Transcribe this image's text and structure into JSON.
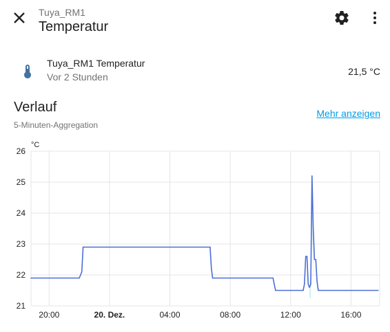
{
  "header": {
    "subtitle": "Tuya_RM1",
    "title": "Temperatur"
  },
  "icons": {
    "close": "close-icon",
    "settings": "gear-icon",
    "more": "more-vertical-icon",
    "entity": "thermometer-icon"
  },
  "entity": {
    "name": "Tuya_RM1 Temperatur",
    "last_changed": "Vor 2 Stunden",
    "value": "21,5 °C"
  },
  "history": {
    "title": "Verlauf",
    "aggregation": "5-Minuten-Aggregation",
    "more_link": "Mehr anzeigen"
  },
  "colors": {
    "line": "#4c6ed6",
    "grid": "#e4e4e4",
    "link": "#039be5",
    "icon": "#44739e"
  },
  "chart_data": {
    "type": "line",
    "ylabel": "°C",
    "ylim": [
      21,
      26
    ],
    "yticks": [
      21,
      22,
      23,
      24,
      25,
      26
    ],
    "xlim": [
      18.8,
      17.9
    ],
    "x_ticks": [
      {
        "label": "20:00",
        "hour": 20,
        "bold": false
      },
      {
        "label": "20. Dez.",
        "hour": 24,
        "bold": true
      },
      {
        "label": "04:00",
        "hour": 28,
        "bold": false
      },
      {
        "label": "08:00",
        "hour": 32,
        "bold": false
      },
      {
        "label": "12:00",
        "hour": 36,
        "bold": false
      },
      {
        "label": "16:00",
        "hour": 40,
        "bold": false
      }
    ],
    "grid": true,
    "series": [
      {
        "points": [
          [
            "19.12.2023 18:48",
            21.9
          ],
          [
            "19.12.2023 22:00",
            21.9
          ],
          [
            "19.12.2023 22:10",
            22.1
          ],
          [
            "19.12.2023 22:15",
            22.9
          ],
          [
            "20.12.2023 06:40",
            22.9
          ],
          [
            "20.12.2023 06:45",
            22.2
          ],
          [
            "20.12.2023 06:50",
            21.9
          ],
          [
            "20.12.2023 10:50",
            21.9
          ],
          [
            "20.12.2023 10:55",
            21.7
          ],
          [
            "20.12.2023 11:00",
            21.5
          ],
          [
            "20.12.2023 12:50",
            21.5
          ],
          [
            "20.12.2023 12:55",
            21.7
          ],
          [
            "20.12.2023 13:00",
            22.6
          ],
          [
            "20.12.2023 13:05",
            22.6
          ],
          [
            "20.12.2023 13:10",
            21.7
          ],
          [
            "20.12.2023 13:15",
            21.6
          ],
          [
            "20.12.2023 13:20",
            21.7
          ],
          [
            "20.12.2023 13:25",
            25.2
          ],
          [
            "20.12.2023 13:30",
            23.5
          ],
          [
            "20.12.2023 13:35",
            22.5
          ],
          [
            "20.12.2023 13:40",
            22.5
          ],
          [
            "20.12.2023 13:45",
            21.8
          ],
          [
            "20.12.2023 13:50",
            21.5
          ],
          [
            "20.12.2023 17:48",
            21.5
          ]
        ]
      }
    ],
    "band": [
      [
        "20.12.2023 13:15",
        21.3,
        21.8
      ],
      [
        "20.12.2023 13:20",
        21.2,
        21.8
      ],
      [
        "20.12.2023 13:25",
        24.6,
        25.4
      ],
      [
        "20.12.2023 13:30",
        21.5,
        24.0
      ]
    ]
  }
}
